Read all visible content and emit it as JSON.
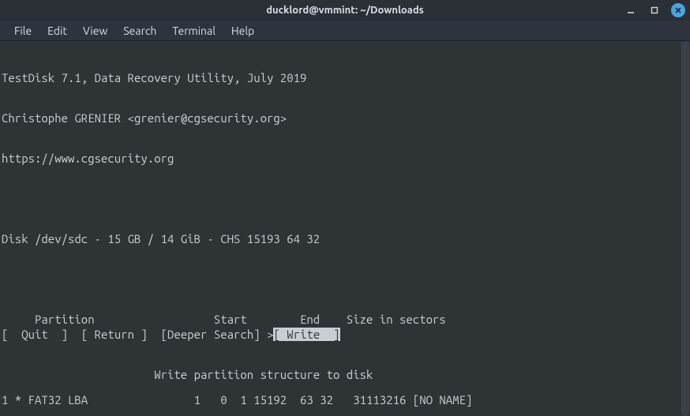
{
  "window": {
    "title": "ducklord@vmmint: ~/Downloads"
  },
  "menus": {
    "file": "File",
    "edit": "Edit",
    "view": "View",
    "search": "Search",
    "terminal": "Terminal",
    "help": "Help"
  },
  "content": {
    "header1": "TestDisk 7.1, Data Recovery Utility, July 2019",
    "header2": "Christophe GRENIER <grenier@cgsecurity.org>",
    "url": "https://www.cgsecurity.org",
    "disk_line": "Disk /dev/sdc - 15 GB / 14 GiB - CHS 15193 64 32",
    "columns": "     Partition                  Start        End    Size in sectors",
    "row1": "1 * FAT32 LBA                1   0  1 15192  63 32   31113216 [NO NAME]"
  },
  "options": {
    "quit": "[  Quit  ]",
    "return": "[ Return ]",
    "deeper": "[Deeper Search]",
    "cursor": ">",
    "write": "[ Write  ]",
    "hint": "                       Write partition structure to disk"
  }
}
